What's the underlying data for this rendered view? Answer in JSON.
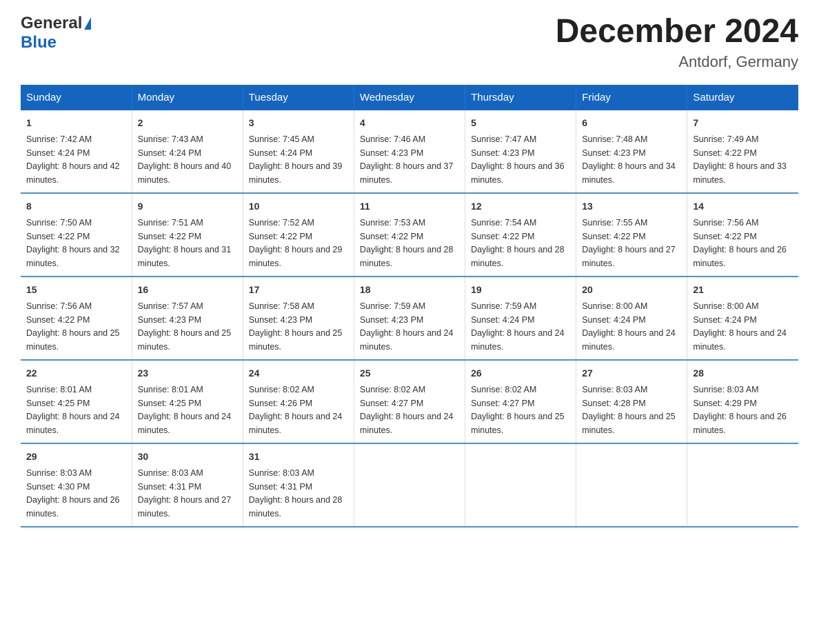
{
  "header": {
    "logo_general": "General",
    "logo_blue": "Blue",
    "month_title": "December 2024",
    "location": "Antdorf, Germany"
  },
  "days_of_week": [
    "Sunday",
    "Monday",
    "Tuesday",
    "Wednesday",
    "Thursday",
    "Friday",
    "Saturday"
  ],
  "weeks": [
    [
      {
        "day": "1",
        "sunrise": "7:42 AM",
        "sunset": "4:24 PM",
        "daylight": "8 hours and 42 minutes."
      },
      {
        "day": "2",
        "sunrise": "7:43 AM",
        "sunset": "4:24 PM",
        "daylight": "8 hours and 40 minutes."
      },
      {
        "day": "3",
        "sunrise": "7:45 AM",
        "sunset": "4:24 PM",
        "daylight": "8 hours and 39 minutes."
      },
      {
        "day": "4",
        "sunrise": "7:46 AM",
        "sunset": "4:23 PM",
        "daylight": "8 hours and 37 minutes."
      },
      {
        "day": "5",
        "sunrise": "7:47 AM",
        "sunset": "4:23 PM",
        "daylight": "8 hours and 36 minutes."
      },
      {
        "day": "6",
        "sunrise": "7:48 AM",
        "sunset": "4:23 PM",
        "daylight": "8 hours and 34 minutes."
      },
      {
        "day": "7",
        "sunrise": "7:49 AM",
        "sunset": "4:22 PM",
        "daylight": "8 hours and 33 minutes."
      }
    ],
    [
      {
        "day": "8",
        "sunrise": "7:50 AM",
        "sunset": "4:22 PM",
        "daylight": "8 hours and 32 minutes."
      },
      {
        "day": "9",
        "sunrise": "7:51 AM",
        "sunset": "4:22 PM",
        "daylight": "8 hours and 31 minutes."
      },
      {
        "day": "10",
        "sunrise": "7:52 AM",
        "sunset": "4:22 PM",
        "daylight": "8 hours and 29 minutes."
      },
      {
        "day": "11",
        "sunrise": "7:53 AM",
        "sunset": "4:22 PM",
        "daylight": "8 hours and 28 minutes."
      },
      {
        "day": "12",
        "sunrise": "7:54 AM",
        "sunset": "4:22 PM",
        "daylight": "8 hours and 28 minutes."
      },
      {
        "day": "13",
        "sunrise": "7:55 AM",
        "sunset": "4:22 PM",
        "daylight": "8 hours and 27 minutes."
      },
      {
        "day": "14",
        "sunrise": "7:56 AM",
        "sunset": "4:22 PM",
        "daylight": "8 hours and 26 minutes."
      }
    ],
    [
      {
        "day": "15",
        "sunrise": "7:56 AM",
        "sunset": "4:22 PM",
        "daylight": "8 hours and 25 minutes."
      },
      {
        "day": "16",
        "sunrise": "7:57 AM",
        "sunset": "4:23 PM",
        "daylight": "8 hours and 25 minutes."
      },
      {
        "day": "17",
        "sunrise": "7:58 AM",
        "sunset": "4:23 PM",
        "daylight": "8 hours and 25 minutes."
      },
      {
        "day": "18",
        "sunrise": "7:59 AM",
        "sunset": "4:23 PM",
        "daylight": "8 hours and 24 minutes."
      },
      {
        "day": "19",
        "sunrise": "7:59 AM",
        "sunset": "4:24 PM",
        "daylight": "8 hours and 24 minutes."
      },
      {
        "day": "20",
        "sunrise": "8:00 AM",
        "sunset": "4:24 PM",
        "daylight": "8 hours and 24 minutes."
      },
      {
        "day": "21",
        "sunrise": "8:00 AM",
        "sunset": "4:24 PM",
        "daylight": "8 hours and 24 minutes."
      }
    ],
    [
      {
        "day": "22",
        "sunrise": "8:01 AM",
        "sunset": "4:25 PM",
        "daylight": "8 hours and 24 minutes."
      },
      {
        "day": "23",
        "sunrise": "8:01 AM",
        "sunset": "4:25 PM",
        "daylight": "8 hours and 24 minutes."
      },
      {
        "day": "24",
        "sunrise": "8:02 AM",
        "sunset": "4:26 PM",
        "daylight": "8 hours and 24 minutes."
      },
      {
        "day": "25",
        "sunrise": "8:02 AM",
        "sunset": "4:27 PM",
        "daylight": "8 hours and 24 minutes."
      },
      {
        "day": "26",
        "sunrise": "8:02 AM",
        "sunset": "4:27 PM",
        "daylight": "8 hours and 25 minutes."
      },
      {
        "day": "27",
        "sunrise": "8:03 AM",
        "sunset": "4:28 PM",
        "daylight": "8 hours and 25 minutes."
      },
      {
        "day": "28",
        "sunrise": "8:03 AM",
        "sunset": "4:29 PM",
        "daylight": "8 hours and 26 minutes."
      }
    ],
    [
      {
        "day": "29",
        "sunrise": "8:03 AM",
        "sunset": "4:30 PM",
        "daylight": "8 hours and 26 minutes."
      },
      {
        "day": "30",
        "sunrise": "8:03 AM",
        "sunset": "4:31 PM",
        "daylight": "8 hours and 27 minutes."
      },
      {
        "day": "31",
        "sunrise": "8:03 AM",
        "sunset": "4:31 PM",
        "daylight": "8 hours and 28 minutes."
      },
      null,
      null,
      null,
      null
    ]
  ],
  "labels": {
    "sunrise": "Sunrise:",
    "sunset": "Sunset:",
    "daylight": "Daylight:"
  }
}
